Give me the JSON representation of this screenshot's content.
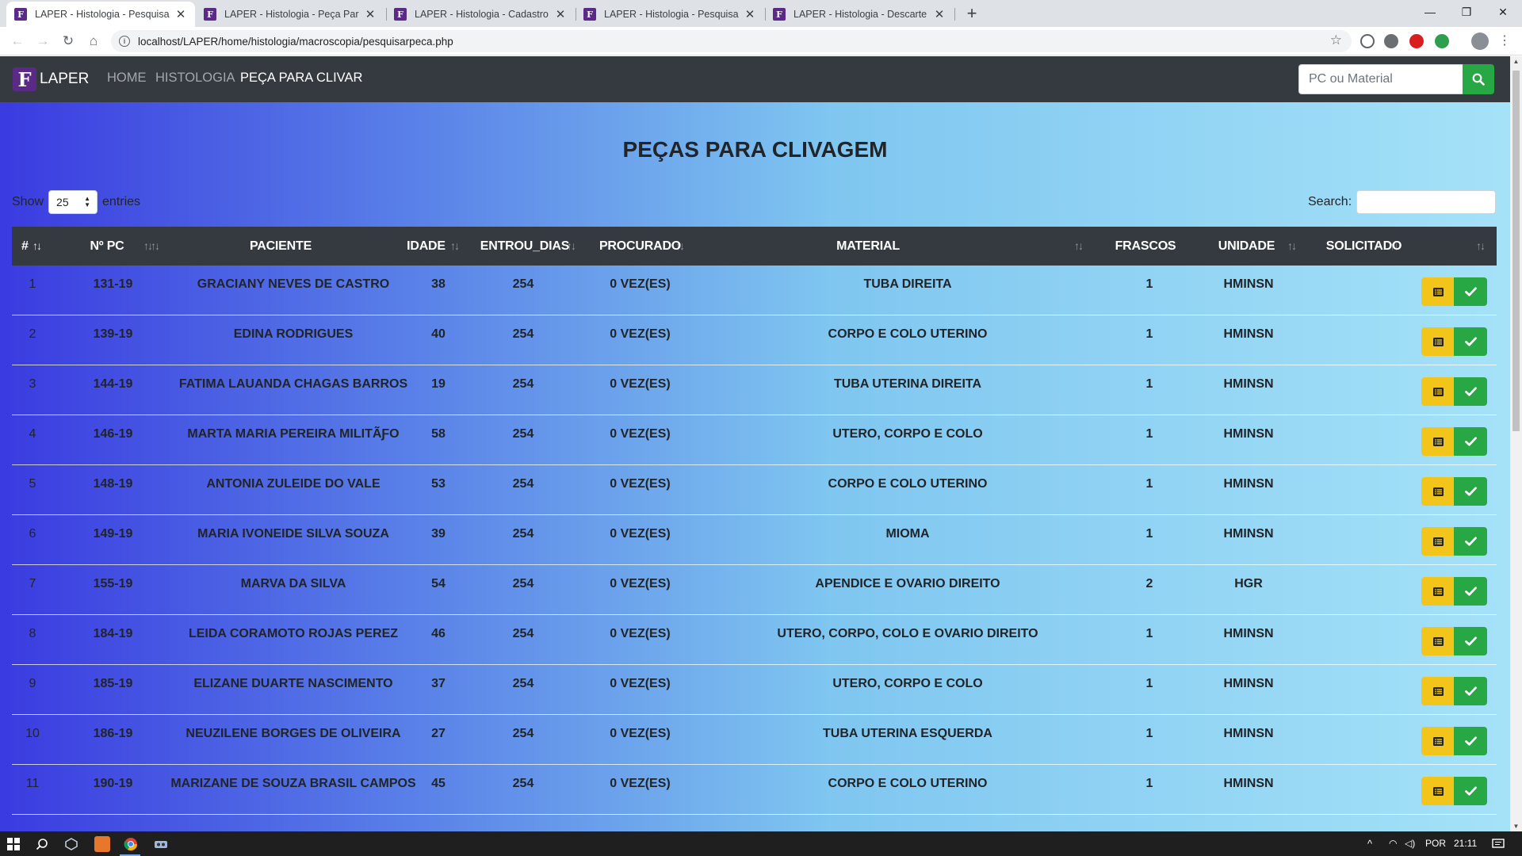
{
  "browser": {
    "tabs": [
      {
        "title": "LAPER - Histologia - Pesquisar Pe",
        "active": true
      },
      {
        "title": "LAPER - Histologia - Peça Para Se",
        "active": false
      },
      {
        "title": "LAPER - Histologia - Cadastro de",
        "active": false
      },
      {
        "title": "LAPER - Histologia - Pesquisar Re",
        "active": false
      },
      {
        "title": "LAPER - Histologia - Descarte",
        "active": false
      }
    ],
    "favicon_letter": "F",
    "url": "localhost/LAPER/home/histologia/macroscopia/pesquisarpeca.php"
  },
  "navbar": {
    "brand": "LAPER",
    "brand_logo": "F",
    "links": [
      {
        "label": "HOME",
        "active": false
      },
      {
        "label": "HISTOLOGIA",
        "active": false
      },
      {
        "label": "PEÇA PARA CLIVAR",
        "active": true
      }
    ],
    "search_placeholder": "PC ou Material"
  },
  "page": {
    "title": "PEÇAS PARA CLIVAGEM",
    "length": {
      "show": "Show",
      "value": "25",
      "entries": "entries"
    },
    "filter_label": "Search:"
  },
  "table": {
    "columns": [
      "#",
      "Nº PC",
      "PACIENTE",
      "IDADE",
      "ENTROU_DIAS",
      "PROCURADO",
      "MATERIAL",
      "FRASCOS",
      "UNIDADE",
      "SOLICITADO",
      ""
    ],
    "rows": [
      {
        "n": "1",
        "pc": "131-19",
        "paciente": "GRACIANY NEVES DE CASTRO",
        "idade": "38",
        "dias": "254",
        "procurado": "0 VEZ(ES)",
        "material": "TUBA DIREITA",
        "frascos": "1",
        "unidade": "HMINSN",
        "solicitado": ""
      },
      {
        "n": "2",
        "pc": "139-19",
        "paciente": "EDINA RODRIGUES",
        "idade": "40",
        "dias": "254",
        "procurado": "0 VEZ(ES)",
        "material": "CORPO E COLO UTERINO",
        "frascos": "1",
        "unidade": "HMINSN",
        "solicitado": ""
      },
      {
        "n": "3",
        "pc": "144-19",
        "paciente": "FATIMA LAUANDA CHAGAS BARROS",
        "idade": "19",
        "dias": "254",
        "procurado": "0 VEZ(ES)",
        "material": "TUBA UTERINA DIREITA",
        "frascos": "1",
        "unidade": "HMINSN",
        "solicitado": ""
      },
      {
        "n": "4",
        "pc": "146-19",
        "paciente": "MARTA MARIA PEREIRA MILITÃƑO",
        "idade": "58",
        "dias": "254",
        "procurado": "0 VEZ(ES)",
        "material": "UTERO, CORPO E COLO",
        "frascos": "1",
        "unidade": "HMINSN",
        "solicitado": ""
      },
      {
        "n": "5",
        "pc": "148-19",
        "paciente": "ANTONIA ZULEIDE DO VALE",
        "idade": "53",
        "dias": "254",
        "procurado": "0 VEZ(ES)",
        "material": "CORPO E COLO UTERINO",
        "frascos": "1",
        "unidade": "HMINSN",
        "solicitado": ""
      },
      {
        "n": "6",
        "pc": "149-19",
        "paciente": "MARIA IVONEIDE SILVA SOUZA",
        "idade": "39",
        "dias": "254",
        "procurado": "0 VEZ(ES)",
        "material": "MIOMA",
        "frascos": "1",
        "unidade": "HMINSN",
        "solicitado": ""
      },
      {
        "n": "7",
        "pc": "155-19",
        "paciente": "MARVA DA SILVA",
        "idade": "54",
        "dias": "254",
        "procurado": "0 VEZ(ES)",
        "material": "APENDICE E OVARIO DIREITO",
        "frascos": "2",
        "unidade": "HGR",
        "solicitado": ""
      },
      {
        "n": "8",
        "pc": "184-19",
        "paciente": "LEIDA CORAMOTO ROJAS PEREZ",
        "idade": "46",
        "dias": "254",
        "procurado": "0 VEZ(ES)",
        "material": "UTERO, CORPO, COLO E OVARIO DIREITO",
        "frascos": "1",
        "unidade": "HMINSN",
        "solicitado": ""
      },
      {
        "n": "9",
        "pc": "185-19",
        "paciente": "ELIZANE DUARTE NASCIMENTO",
        "idade": "37",
        "dias": "254",
        "procurado": "0 VEZ(ES)",
        "material": "UTERO, CORPO E COLO",
        "frascos": "1",
        "unidade": "HMINSN",
        "solicitado": ""
      },
      {
        "n": "10",
        "pc": "186-19",
        "paciente": "NEUZILENE BORGES DE OLIVEIRA",
        "idade": "27",
        "dias": "254",
        "procurado": "0 VEZ(ES)",
        "material": "TUBA UTERINA ESQUERDA",
        "frascos": "1",
        "unidade": "HMINSN",
        "solicitado": ""
      },
      {
        "n": "11",
        "pc": "190-19",
        "paciente": "MARIZANE DE SOUZA BRASIL CAMPOS",
        "idade": "45",
        "dias": "254",
        "procurado": "0 VEZ(ES)",
        "material": "CORPO E COLO UTERINO",
        "frascos": "1",
        "unidade": "HMINSN",
        "solicitado": ""
      }
    ],
    "action_icons": {
      "details": "list-icon",
      "confirm": "check-icon"
    }
  },
  "taskbar": {
    "lang": "POR",
    "time": "21:11"
  },
  "colors": {
    "navbar": "#343a40",
    "success": "#28a745",
    "warning": "#f3c51b",
    "brand_purple": "#5b2a86",
    "gradient_left": "#3a3be0",
    "gradient_right": "#a5e2f8"
  }
}
